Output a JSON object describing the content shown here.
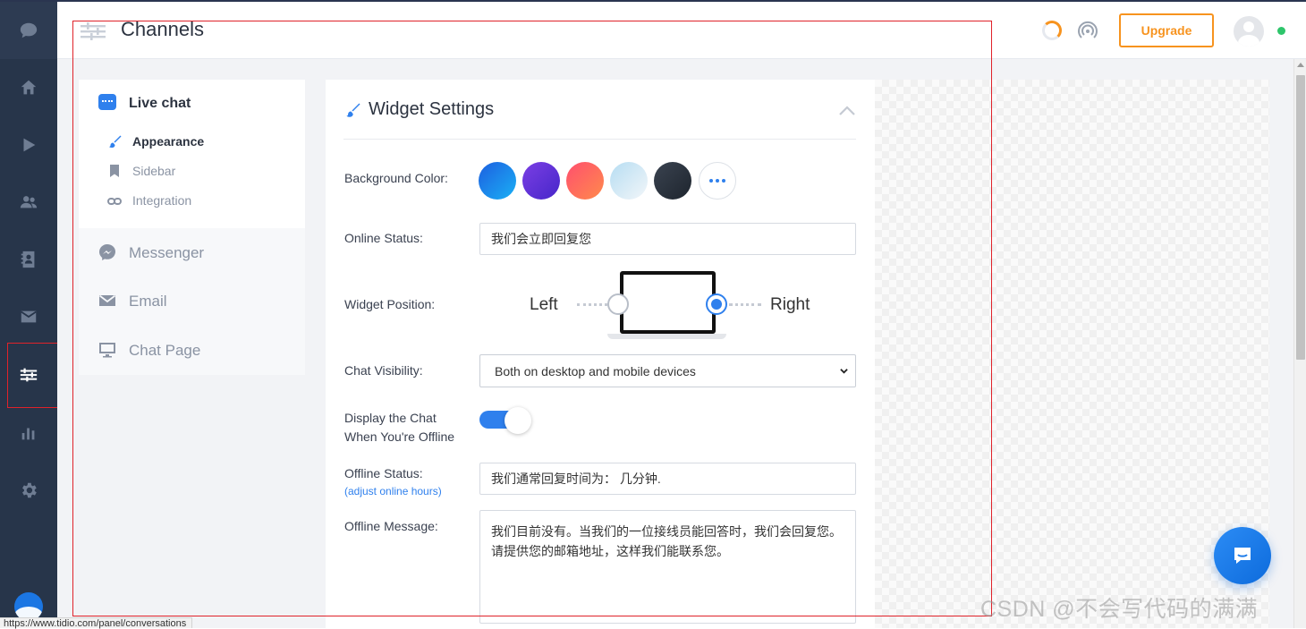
{
  "app": {
    "title": "Channels",
    "upgrade_label": "Upgrade"
  },
  "rail": {
    "items": [
      "home-icon",
      "play-icon",
      "visitors-icon",
      "contacts-icon",
      "inbox-icon",
      "channels-icon",
      "analytics-icon",
      "settings-icon"
    ],
    "active": "channels-icon"
  },
  "menu": {
    "live_chat": "Live chat",
    "subitems": [
      {
        "label": "Appearance",
        "icon": "brush-icon"
      },
      {
        "label": "Sidebar",
        "icon": "bookmark-icon"
      },
      {
        "label": "Integration",
        "icon": "link-icon"
      }
    ],
    "channels": [
      {
        "label": "Messenger",
        "icon": "messenger-icon"
      },
      {
        "label": "Email",
        "icon": "envelope-icon"
      },
      {
        "label": "Chat Page",
        "icon": "monitor-icon"
      }
    ]
  },
  "widget": {
    "title": "Widget Settings",
    "background_color_label": "Background Color:",
    "colors": [
      "#1a73e8",
      "#5b2ed1",
      "#ff5a5f",
      "#cfe6f3",
      "#2b3440"
    ],
    "online_status_label": "Online Status:",
    "online_status_value": "我们会立即回复您",
    "widget_position_label": "Widget Position:",
    "position_left": "Left",
    "position_right": "Right",
    "position_selected": "Right",
    "chat_visibility_label": "Chat Visibility:",
    "chat_visibility_value": "Both on desktop and mobile devices",
    "display_offline_label_1": "Display the Chat",
    "display_offline_label_2": "When You're Offline",
    "display_offline_enabled": true,
    "offline_status_label": "Offline Status:",
    "offline_status_link": "(adjust online hours)",
    "offline_status_value": "我们通常回复时间为： 几分钟.",
    "offline_message_label": "Offline Message:",
    "offline_message_value": "我们目前没有。当我们的一位接线员能回答时，我们会回复您。请提供您的邮箱地址，这样我们能联系您。"
  },
  "status_bar": {
    "url": "https://www.tidio.com/panel/conversations"
  },
  "watermark": "CSDN @不会写代码的满满"
}
